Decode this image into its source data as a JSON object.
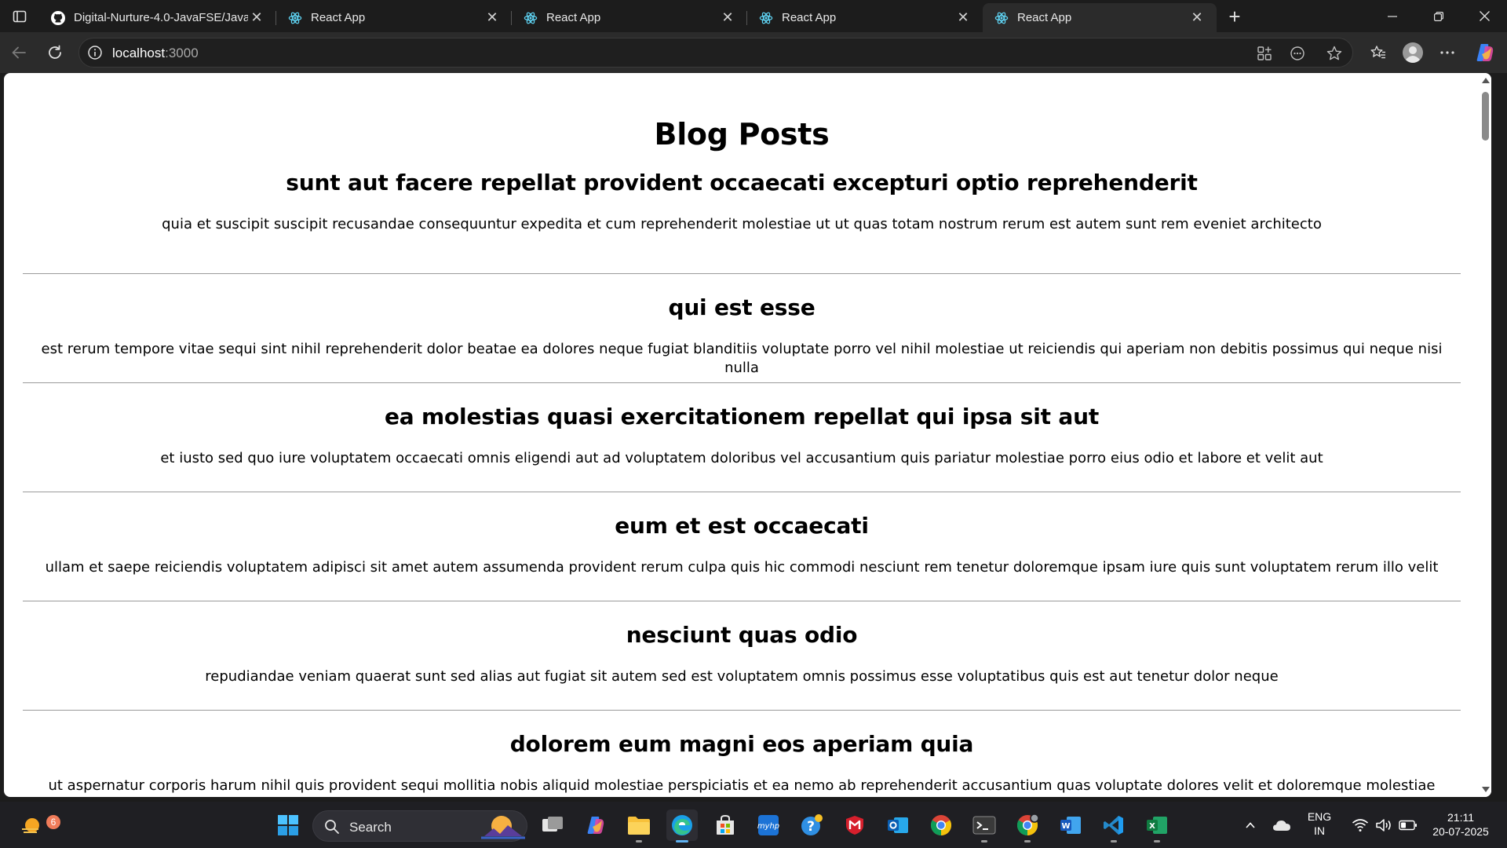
{
  "browser": {
    "tabs": [
      {
        "title": "Digital-Nurture-4.0-JavaFSE/Java",
        "favicon": "github-icon",
        "active": false
      },
      {
        "title": "React App",
        "favicon": "react-icon",
        "active": false
      },
      {
        "title": "React App",
        "favicon": "react-icon",
        "active": false
      },
      {
        "title": "React App",
        "favicon": "react-icon",
        "active": false
      },
      {
        "title": "React App",
        "favicon": "react-icon",
        "active": true
      }
    ],
    "url_host": "localhost",
    "url_port": ":3000"
  },
  "page": {
    "title": "Blog Posts",
    "posts": [
      {
        "title": "sunt aut facere repellat provident occaecati excepturi optio reprehenderit",
        "body": "quia et suscipit suscipit recusandae consequuntur expedita et cum reprehenderit molestiae ut ut quas totam nostrum rerum est autem sunt rem eveniet architecto"
      },
      {
        "title": "qui est esse",
        "body": "est rerum tempore vitae sequi sint nihil reprehenderit dolor beatae ea dolores neque fugiat blanditiis voluptate porro vel nihil molestiae ut reiciendis qui aperiam non debitis possimus qui neque nisi nulla"
      },
      {
        "title": "ea molestias quasi exercitationem repellat qui ipsa sit aut",
        "body": "et iusto sed quo iure voluptatem occaecati omnis eligendi aut ad voluptatem doloribus vel accusantium quis pariatur molestiae porro eius odio et labore et velit aut"
      },
      {
        "title": "eum et est occaecati",
        "body": "ullam et saepe reiciendis voluptatem adipisci sit amet autem assumenda provident rerum culpa quis hic commodi nesciunt rem tenetur doloremque ipsam iure quis sunt voluptatem rerum illo velit"
      },
      {
        "title": "nesciunt quas odio",
        "body": "repudiandae veniam quaerat sunt sed alias aut fugiat sit autem sed est voluptatem omnis possimus esse voluptatibus quis est aut tenetur dolor neque"
      },
      {
        "title": "dolorem eum magni eos aperiam quia",
        "body": "ut aspernatur corporis harum nihil quis provident sequi mollitia nobis aliquid molestiae perspiciatis et ea nemo ab reprehenderit accusantium quas voluptate dolores velit et doloremque molestiae"
      }
    ]
  },
  "taskbar": {
    "weather_badge": "6",
    "search_label": "Search",
    "language_line1": "ENG",
    "language_line2": "IN",
    "time": "21:11",
    "date": "20-07-2025"
  },
  "colors": {
    "browser_dark": "#1c1c1c",
    "toolbar": "#2b2b2b",
    "taskbar": "#1f1f23",
    "active_indicator": "#5fb2f2"
  }
}
